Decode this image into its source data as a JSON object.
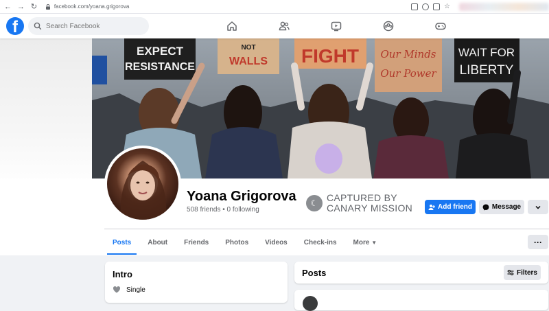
{
  "browser": {
    "url": "facebook.com/yoana.grigorova"
  },
  "header": {
    "search_placeholder": "Search Facebook",
    "logo_letter": "f"
  },
  "cover": {
    "signs": [
      "EXPECT RESISTANCE",
      "NOT WALLS",
      "FIGHT",
      "Our Minds Our Power",
      "WAIT FOR LIBERTY"
    ]
  },
  "profile": {
    "name": "Yoana Grigorova",
    "stats": "508 friends • 0 following"
  },
  "watermark": {
    "line1": "CAPTURED BY",
    "line2": "CANARY MISSION"
  },
  "actions": {
    "add_friend": "Add friend",
    "message": "Message"
  },
  "tabs": [
    "Posts",
    "About",
    "Friends",
    "Photos",
    "Videos",
    "Check-ins",
    "More"
  ],
  "intro": {
    "title": "Intro",
    "relationship": "Single"
  },
  "posts": {
    "title": "Posts",
    "filters": "Filters"
  },
  "colors": {
    "accent": "#1877f2",
    "background": "#f0f2f5"
  }
}
